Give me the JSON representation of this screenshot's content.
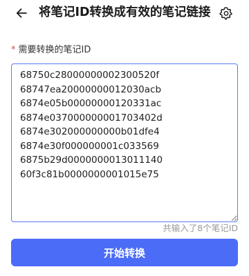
{
  "header": {
    "title": "将笔记ID转换成有效的笔记链接",
    "back_icon": "arrow-left-icon",
    "settings_icon": "gear-icon"
  },
  "form": {
    "required_mark": "*",
    "label": "需要转换的笔记ID",
    "ids_value": "68750c28000000002300520f\n68747ea20000000012030acb\n6874e05b00000000120331ac\n6874e037000000001703402d\n6874e302000000000b01dfe4\n6874e30f000000001c033569\n6875b29d0000000013011140\n60f3c81b0000000001015e75",
    "counter_text": "共输入了8个笔记ID",
    "submit_label": "开始转换"
  },
  "colors": {
    "accent": "#4b6cf7",
    "input_border": "#5b7bf0",
    "required": "#e5484d",
    "muted_text": "#999999"
  }
}
